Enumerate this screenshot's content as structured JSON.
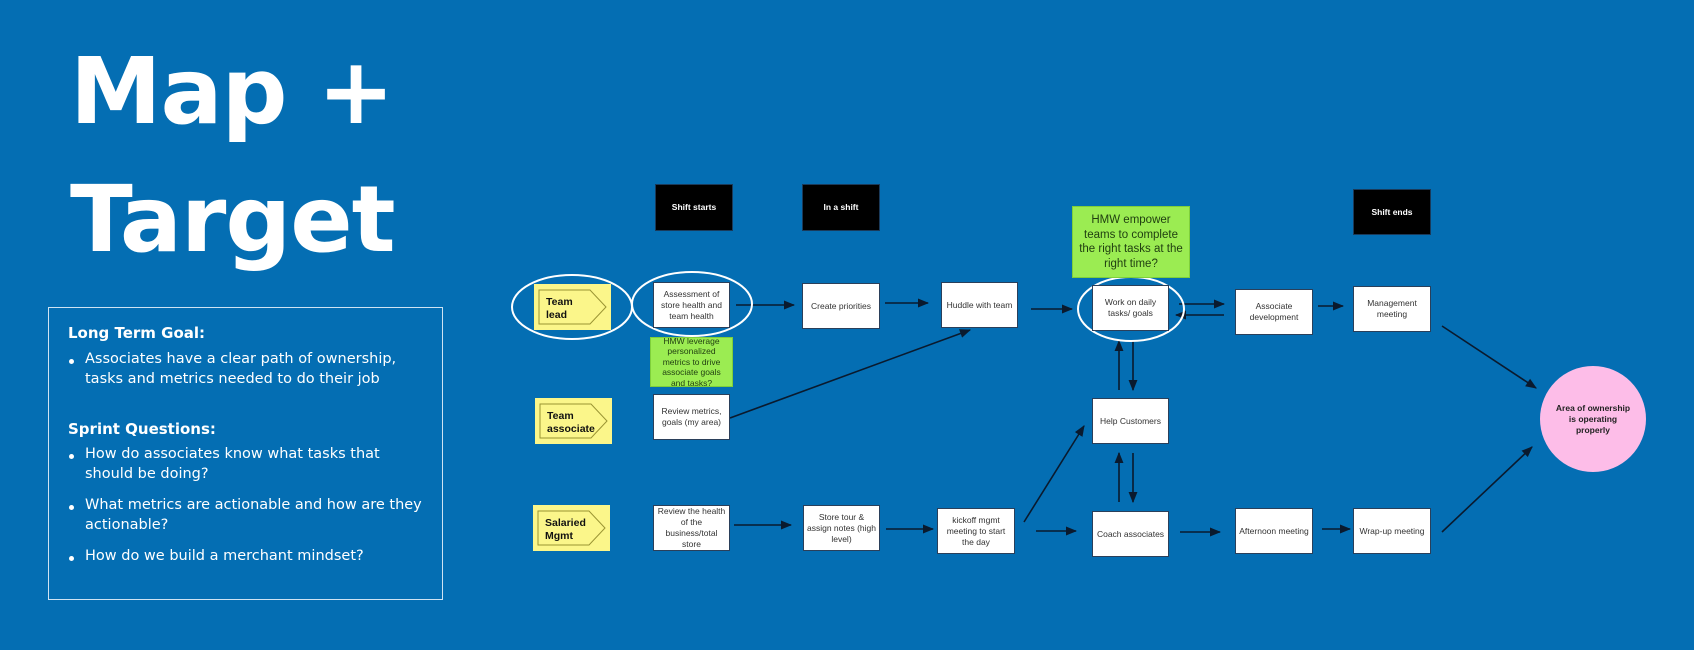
{
  "title": {
    "line1": "Map +",
    "line2": "Target"
  },
  "goal_panel": {
    "long_term_heading": "Long Term Goal:",
    "long_term_items": [
      "Associates have a clear path of ownership, tasks and metrics needed to do their job"
    ],
    "sprint_heading": "Sprint Questions:",
    "sprint_items": [
      "How do associates know what tasks that should be doing?",
      "What metrics are actionable and how are they actionable?",
      "How do we build a merchant mindset?"
    ]
  },
  "phases": {
    "shift_starts": "Shift starts",
    "in_a_shift": "In a shift",
    "shift_ends": "Shift ends"
  },
  "roles": {
    "team_lead": [
      "Team",
      "lead"
    ],
    "team_associate": [
      "Team",
      "associate"
    ],
    "salaried_mgmt": [
      "Salaried",
      "Mgmt"
    ]
  },
  "steps": {
    "assessment": "Assessment of store health and team health",
    "create_priorities": "Create priorities",
    "huddle": "Huddle with team",
    "work_daily": "Work on daily tasks/ goals",
    "associate_dev": "Associate development",
    "mgmt_meeting": "Management meeting",
    "review_metrics": "Review metrics, goals (my area)",
    "help_customers": "Help Customers",
    "review_health": "Review the health of the business/total store",
    "store_tour": "Store tour & assign notes (high level)",
    "kickoff": "kickoff mgmt meeting to start the day",
    "coach": "Coach associates",
    "afternoon": "Afternoon meeting",
    "wrapup": "Wrap-up meeting"
  },
  "hmw": {
    "metrics": "HMW leverage personalized metrics to drive associate goals and tasks?",
    "empower": "HMW empower teams to complete the right tasks at the right time?"
  },
  "target": "Area of ownership is operating properly",
  "colors": {
    "background": "#046eb3",
    "hmw_green": "#9bec52",
    "role_yellow": "#fbf68a",
    "target_pink": "#fdbde8",
    "phase_black": "#000000"
  }
}
